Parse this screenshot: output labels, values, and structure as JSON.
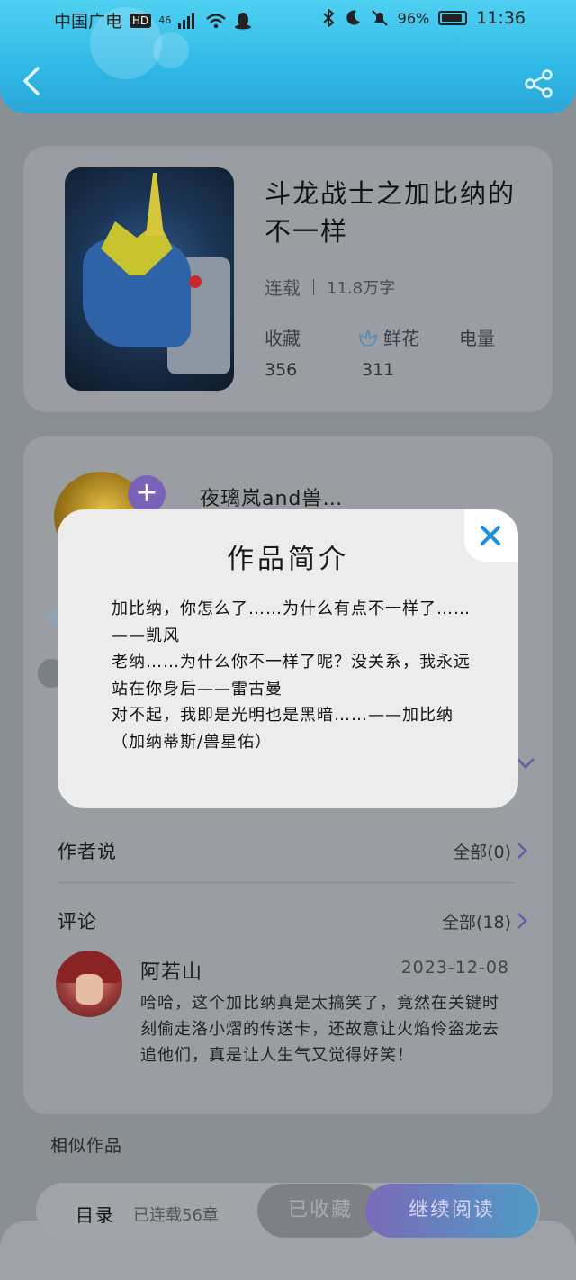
{
  "status_bar": {
    "carrier": "中国广电",
    "hd": "HD",
    "network": "46",
    "battery_percent": "96%",
    "time": "11:36"
  },
  "book": {
    "title": "斗龙战士之加比纳的不一样",
    "status": "连载",
    "word_count": "11.8万字",
    "stats": {
      "favorites_label": "收藏",
      "flowers_label": "鲜花",
      "power_label": "电量",
      "favorites_value": "356",
      "flowers_value": "311"
    }
  },
  "author": {
    "name": "夜璃岚and兽…"
  },
  "author_notes": {
    "title": "作者说",
    "link": "全部(0)"
  },
  "comments": {
    "title": "评论",
    "link": "全部(18)",
    "items": [
      {
        "user": "阿若山",
        "date": "2023-12-08",
        "text": "哈哈，这个加比纳真是太搞笑了，竟然在关键时刻偷走洛小熠的传送卡，还故意让火焰伶盗龙去追他们，真是让人生气又觉得好笑！"
      }
    ]
  },
  "similar": {
    "title": "相似作品"
  },
  "bottom_bar": {
    "toc": "目录",
    "chapters": "已连载56章",
    "collected": "已收藏",
    "continue": "继续阅读"
  },
  "modal": {
    "title": "作品简介",
    "lines": [
      "加比纳，你怎么了……为什么有点不一样了……——凯风",
      "老纳……为什么你不一样了呢？没关系，我永远站在你身后——雷古曼",
      "对不起，我即是光明也是黑暗……——加比纳（加纳蒂斯/兽星佑）"
    ]
  },
  "colors": {
    "header": "#2fb8e6",
    "accent_purple": "#7b6ab8",
    "close_blue": "#1b8fe0"
  }
}
